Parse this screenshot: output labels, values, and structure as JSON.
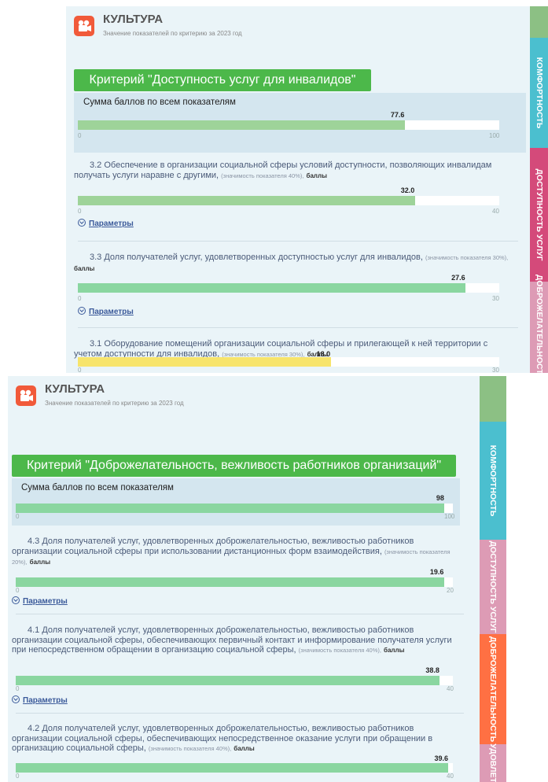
{
  "colors": {
    "panel_bg": "#eaf4f8",
    "criterion_green": "#4cb84a",
    "bar_green": "#9ed399",
    "bar_yellow": "#f7e46b",
    "tab_green": "#8cc084",
    "tab_teal": "#4bbfcf",
    "tab_pink": "#d44a7a",
    "tab_pink_light": "#dd9bb5",
    "tab_orange": "#ff7043"
  },
  "screen1": {
    "header": {
      "title": "КУЛЬТУРА",
      "subtitle": "Значение показателей по критерию за 2023 год",
      "logo_icon": "camera-icon"
    },
    "criterion_title": "Критерий \"Доступность услуг для инвалидов\"",
    "summary": {
      "label": "Сумма баллов по всем показателям",
      "value": "77.6",
      "value_num": 77.6,
      "min": "0",
      "max": "100",
      "max_num": 100
    },
    "indicators": [
      {
        "code": "3.2",
        "text": "3.2 Обеспечение в организации социальной сферы условий доступности, позволяющих инвалидам получать услуги наравне с другими,",
        "weight": "(значимость показателя 40%),",
        "unit": "баллы",
        "value": "32.0",
        "value_num": 32.0,
        "min": "0",
        "max": "40",
        "max_num": 40,
        "params_label": "Параметры"
      },
      {
        "code": "3.3",
        "text": "3.3 Доля получателей услуг, удовлетворенных доступностью услуг для инвалидов,",
        "weight": "(значимость показателя 30%),",
        "unit": "баллы",
        "value": "27.6",
        "value_num": 27.6,
        "min": "0",
        "max": "30",
        "max_num": 30,
        "params_label": "Параметры"
      },
      {
        "code": "3.1",
        "text": "3.1 Оборудование помещений организации социальной сферы и прилегающей к ней территории с учетом доступности для инвалидов,",
        "weight": "(значимость показателя 30%),",
        "unit": "баллы",
        "value": "18.0",
        "value_num": 18.0,
        "min": "0",
        "max": "30",
        "max_num": 30
      }
    ],
    "tabs": [
      {
        "label": "КОМФОРТНОСТЬ"
      },
      {
        "label": "ДОСТУПНОСТЬ УСЛУГ"
      },
      {
        "label": "ДОБРОЖЕЛАТЕЛЬНОСТЬ"
      }
    ]
  },
  "screen2": {
    "header": {
      "title": "КУЛЬТУРА",
      "subtitle": "Значение показателей по критерию за 2023 год",
      "logo_icon": "camera-icon"
    },
    "criterion_title": "Критерий \"Доброжелательность, вежливость работников организаций\"",
    "summary": {
      "label": "Сумма баллов по всем показателям",
      "value": "98",
      "value_num": 98,
      "min": "0",
      "max": "100",
      "max_num": 100
    },
    "indicators": [
      {
        "code": "4.3",
        "text": "4.3 Доля получателей услуг, удовлетворенных доброжелательностью, вежливостью работников организации социальной сферы при использовании дистанционных форм взаимодействия,",
        "weight": "(значимость показателя 20%),",
        "unit": "баллы",
        "value": "19.6",
        "value_num": 19.6,
        "min": "0",
        "max": "20",
        "max_num": 20,
        "params_label": "Параметры"
      },
      {
        "code": "4.1",
        "text": "4.1 Доля получателей услуг, удовлетворенных доброжелательностью, вежливостью работников организации социальной сферы, обеспечивающих первичный контакт и информирование получателя услуги при непосредственном обращении в организацию социальной сферы,",
        "weight": "(значимость показателя 40%),",
        "unit": "баллы",
        "value": "38.8",
        "value_num": 38.8,
        "min": "0",
        "max": "40",
        "max_num": 40,
        "params_label": "Параметры"
      },
      {
        "code": "4.2",
        "text": "4.2 Доля получателей услуг, удовлетворенных доброжелательностью, вежливостью работников организации социальной сферы, обеспечивающих непосредственное оказание услуги при обращении в организацию социальной сферы,",
        "weight": "(значимость показателя 40%),",
        "unit": "баллы",
        "value": "39.6",
        "value_num": 39.6,
        "min": "0",
        "max": "40",
        "max_num": 40
      }
    ],
    "tabs": [
      {
        "label": "КОМФОРТНОСТЬ"
      },
      {
        "label": "ДОСТУПНОСТЬ УСЛУГ"
      },
      {
        "label": "ДОБРОЖЕЛАТЕЛЬНОСТЬ"
      },
      {
        "label": "УДОВЛЕТ"
      }
    ]
  }
}
